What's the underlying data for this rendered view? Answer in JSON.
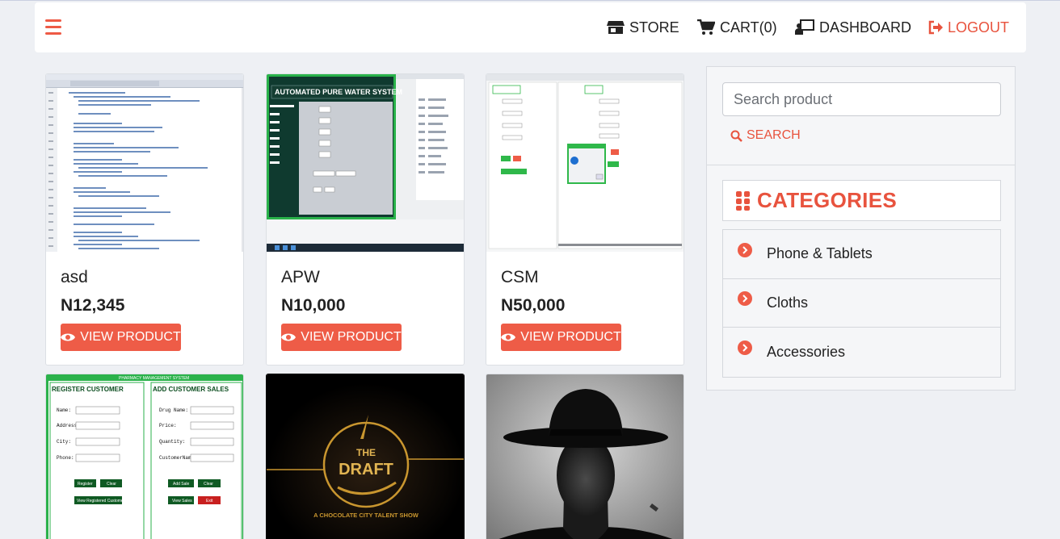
{
  "nav": {
    "store": "STORE",
    "cart": "CART(0)",
    "dashboard": "DASHBOARD",
    "logout": "LOGOUT"
  },
  "products": [
    {
      "name": "asd",
      "price": "N12,345",
      "button": "VIEW PRODUCT"
    },
    {
      "name": "APW",
      "price": "N10,000",
      "button": "VIEW PRODUCT"
    },
    {
      "name": "CSM",
      "price": "N50,000",
      "button": "VIEW PRODUCT"
    }
  ],
  "thumbs": {
    "apw_title": "AUTOMATED PURE WATER SYSTEM",
    "pharmacy_title": "PHARMACY MANAGEMENT SYSTEM",
    "register_customer": "REGISTER CUSTOMER",
    "add_customer_sales": "ADD CUSTOMER SALES",
    "fields_left": [
      "Name:",
      "Address:",
      "City:",
      "Phone:"
    ],
    "fields_right": [
      "Drug Name:",
      "Price:",
      "Quantity:",
      "CustomerName:"
    ],
    "btn_register": "Register",
    "btn_clear": "Clear",
    "btn_view_registered": "View Registered Customers",
    "btn_add_sale": "Add Sale",
    "btn_view_sales": "View Sales",
    "btn_exit": "Exit",
    "draft_the": "THE",
    "draft_word": "DRAFT",
    "draft_tagline": "A CHOCOLATE CITY TALENT SHOW"
  },
  "sidebar": {
    "search_placeholder": "Search product",
    "search_button": "SEARCH",
    "categories_title": "CATEGORIES",
    "categories": [
      "Phone & Tablets",
      "Cloths",
      "Accessories"
    ]
  },
  "colors": {
    "accent": "#ee5c47",
    "background": "#eef0f4"
  }
}
